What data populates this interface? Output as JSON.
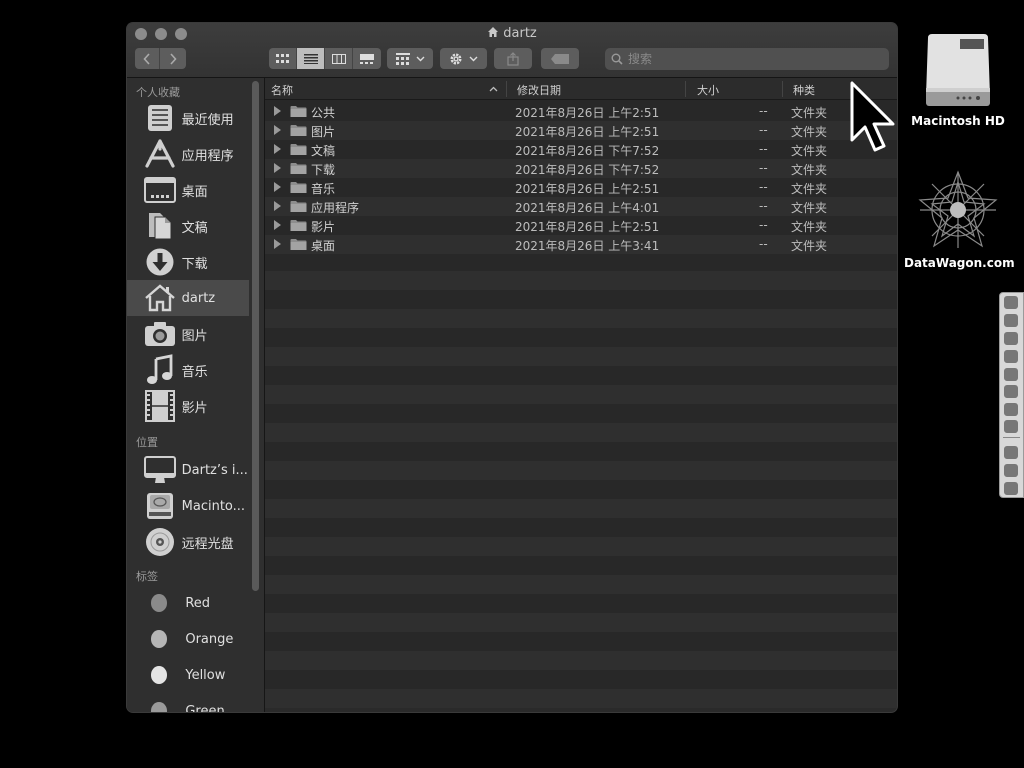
{
  "window": {
    "title": "dartz",
    "search": {
      "placeholder": "搜索",
      "value": ""
    }
  },
  "toolbar": {
    "back_icon": "chevron-left-icon",
    "forward_icon": "chevron-right-icon",
    "view_modes": [
      "icon-view-icon",
      "list-view-icon",
      "column-view-icon",
      "gallery-view-icon"
    ],
    "active_view": "list",
    "group_icon": "group-grid-icon",
    "action_icon": "gear-icon",
    "share_icon": "share-icon",
    "tag_icon": "tag-icon"
  },
  "sidebar": {
    "favorites_header": "个人收藏",
    "favorites": [
      {
        "label": "最近使用",
        "icon": "recents-icon"
      },
      {
        "label": "应用程序",
        "icon": "applications-icon"
      },
      {
        "label": "桌面",
        "icon": "desktop-icon"
      },
      {
        "label": "文稿",
        "icon": "documents-icon"
      },
      {
        "label": "下载",
        "icon": "downloads-icon"
      },
      {
        "label": "dartz",
        "icon": "home-icon"
      },
      {
        "label": "图片",
        "icon": "camera-icon"
      },
      {
        "label": "音乐",
        "icon": "music-note-icon"
      },
      {
        "label": "影片",
        "icon": "film-icon"
      }
    ],
    "active_favorite": "dartz",
    "locations_header": "位置",
    "locations": [
      {
        "label": "Dartz’s i...",
        "icon": "imac-icon"
      },
      {
        "label": "Macinto...",
        "icon": "hard-drive-icon"
      },
      {
        "label": "远程光盘",
        "icon": "optical-disc-icon"
      }
    ],
    "tags_header": "标签",
    "tags": [
      {
        "label": "Red",
        "color": "#8a8a8a"
      },
      {
        "label": "Orange",
        "color": "#b5b5b5"
      },
      {
        "label": "Yellow",
        "color": "#e4e4e4"
      },
      {
        "label": "Green",
        "color": "#9a9a9a"
      }
    ]
  },
  "list": {
    "columns": {
      "name": "名称",
      "modified": "修改日期",
      "size": "大小",
      "kind": "种类"
    },
    "rows": [
      {
        "name": "公共",
        "modified": "2021年8月26日 上午2:51",
        "size": "--",
        "kind": "文件夹"
      },
      {
        "name": "图片",
        "modified": "2021年8月26日 上午2:51",
        "size": "--",
        "kind": "文件夹"
      },
      {
        "name": "文稿",
        "modified": "2021年8月26日 下午7:52",
        "size": "--",
        "kind": "文件夹"
      },
      {
        "name": "下载",
        "modified": "2021年8月26日 下午7:52",
        "size": "--",
        "kind": "文件夹"
      },
      {
        "name": "音乐",
        "modified": "2021年8月26日 上午2:51",
        "size": "--",
        "kind": "文件夹"
      },
      {
        "name": "应用程序",
        "modified": "2021年8月26日 上午4:01",
        "size": "--",
        "kind": "文件夹"
      },
      {
        "name": "影片",
        "modified": "2021年8月26日 上午2:51",
        "size": "--",
        "kind": "文件夹"
      },
      {
        "name": "桌面",
        "modified": "2021年8月26日 上午3:41",
        "size": "--",
        "kind": "文件夹"
      }
    ]
  },
  "desktop": {
    "icons": [
      {
        "label": "Macintosh HD",
        "icon": "hard-drive-icon"
      },
      {
        "label": "DataWagon.com",
        "icon": "star-logo-icon"
      }
    ]
  },
  "dock": {
    "items": [
      "finder-icon",
      "launchpad-icon",
      "safari-icon",
      "compass-icon",
      "calendar-icon",
      "notes-icon",
      "app-store-icon",
      "system-preferences-icon",
      "document-icon",
      "folder-icon",
      "trash-icon"
    ]
  }
}
